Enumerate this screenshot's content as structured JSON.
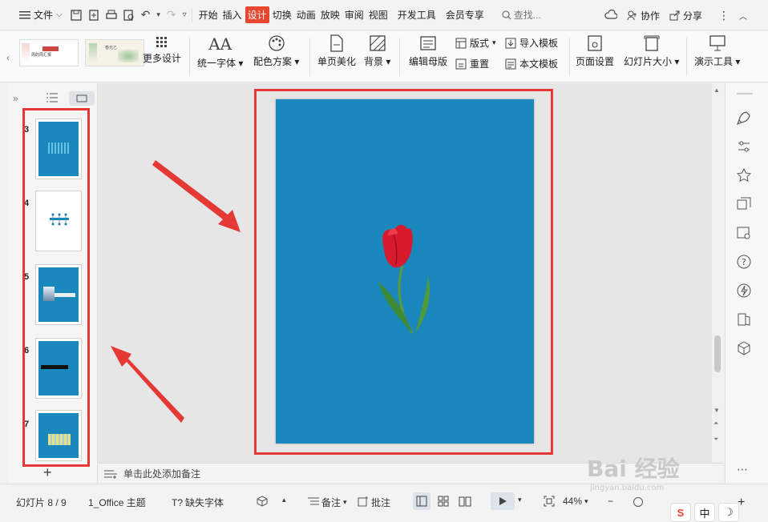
{
  "menubar": {
    "file_label": "文件",
    "tabs": [
      "开始",
      "插入",
      "设计",
      "切换",
      "动画",
      "放映",
      "审阅",
      "视图",
      "开发工具",
      "会员专享"
    ],
    "active_tab": "设计",
    "search_placeholder": "查找...",
    "collab_label": "协作",
    "share_label": "分享"
  },
  "ribbon": {
    "more_design": "更多设计",
    "unify_font": "统一字体",
    "color_scheme": "配色方案",
    "page_beautify": "单页美化",
    "background": "背景",
    "edit_master": "编辑母版",
    "layout": "版式",
    "reset": "重置",
    "import_template": "导入模板",
    "this_template": "本文模板",
    "page_setup": "页面设置",
    "slide_size": "幻灯片大小",
    "present_tools": "演示工具",
    "template1_text": "周的周汇报",
    "template2_text": "春光乙"
  },
  "slides_panel": {
    "slides": [
      {
        "num": "3",
        "color": "#1a88bc"
      },
      {
        "num": "4",
        "color": "#ffffff"
      },
      {
        "num": "5",
        "color": "#1a88bc"
      },
      {
        "num": "6",
        "color": "#1a88bc"
      },
      {
        "num": "7",
        "color": "#1a88bc"
      }
    ]
  },
  "canvas": {
    "slide_bg": "#1a88bc",
    "notes_placeholder": "单击此处添加备注"
  },
  "statusbar": {
    "slide_count": "幻灯片 8 / 9",
    "theme": "1_Office 主题",
    "missing_font": "缺失字体",
    "notes": "备注",
    "comments": "批注",
    "zoom": "44%"
  },
  "watermark": "Bai 经验",
  "watermark_sub": "jingyan.baidu.com",
  "ime": {
    "lang": "中"
  }
}
